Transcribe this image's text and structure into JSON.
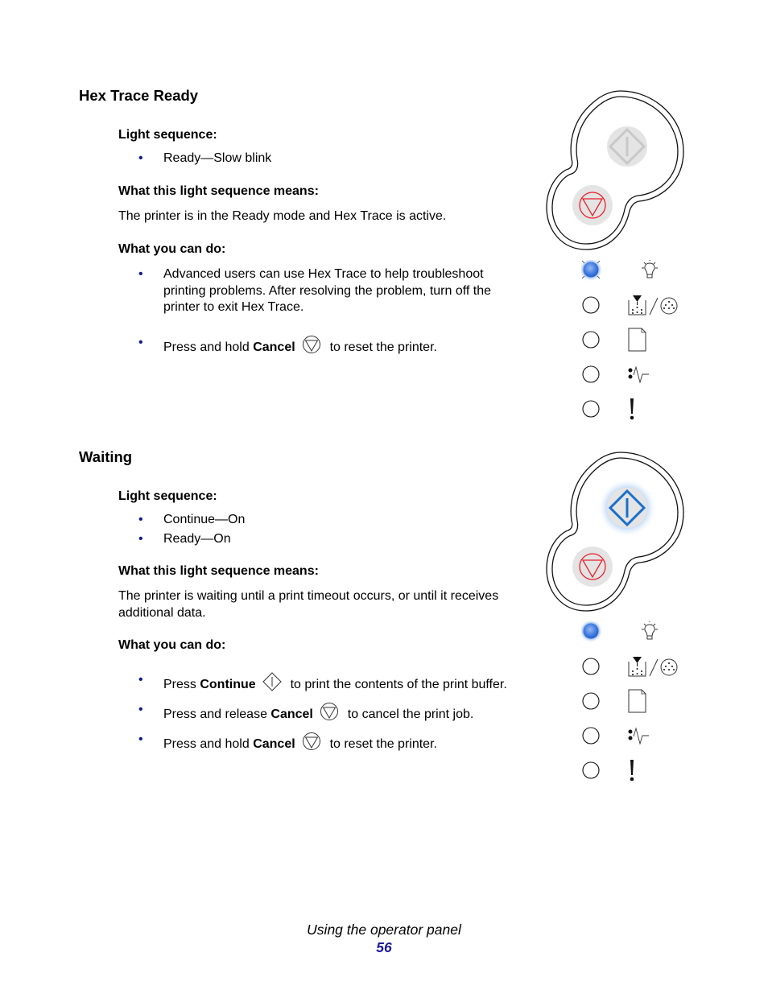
{
  "sections": [
    {
      "title": "Hex Trace Ready",
      "light_sequence_label": "Light sequence:",
      "light_sequence": [
        "Ready—Slow blink"
      ],
      "means_label": "What this light sequence means:",
      "means_text": "The printer is in the Ready mode and Hex Trace is active.",
      "actions_label": "What you can do:",
      "actions": [
        {
          "text": "Advanced users can use Hex Trace to help troubleshoot printing problems. After resolving the problem, turn off the printer to exit Hex Trace."
        },
        {
          "pre": "Press and hold ",
          "bold": "Cancel",
          "icon": "cancel-icon",
          "post": "to reset the printer."
        }
      ],
      "panel": {
        "continue_button": {
          "icon": "continue-icon",
          "state": "off"
        },
        "cancel_button": {
          "icon": "cancel-icon",
          "state": "on",
          "color": "#e8202a"
        },
        "lights": [
          {
            "name": "ready",
            "icon": "lightbulb-icon",
            "state": "slow-blink",
            "color": "#3a78e0"
          },
          {
            "name": "toner-low",
            "icon": "toner-drum-icon",
            "state": "off"
          },
          {
            "name": "load-paper",
            "icon": "paper-icon",
            "state": "off"
          },
          {
            "name": "paper-jam",
            "icon": "paper-jam-icon",
            "state": "off"
          },
          {
            "name": "error",
            "icon": "exclamation-icon",
            "state": "off"
          }
        ]
      }
    },
    {
      "title": "Waiting",
      "light_sequence_label": "Light sequence:",
      "light_sequence": [
        "Continue—On",
        "Ready—On"
      ],
      "means_label": "What this light sequence means:",
      "means_text": "The printer is waiting until a print timeout occurs, or until it receives additional data.",
      "actions_label": "What you can do:",
      "actions": [
        {
          "pre": "Press ",
          "bold": "Continue",
          "icon": "continue-icon",
          "post": "to print the contents of the print buffer."
        },
        {
          "pre": "Press and release ",
          "bold": "Cancel",
          "icon": "cancel-icon",
          "post": "to cancel the print job."
        },
        {
          "pre": "Press and hold ",
          "bold": "Cancel",
          "icon": "cancel-icon",
          "post": "to reset the printer."
        }
      ],
      "panel": {
        "continue_button": {
          "icon": "continue-icon",
          "state": "on",
          "color": "#1a6fcc"
        },
        "cancel_button": {
          "icon": "cancel-icon",
          "state": "on",
          "color": "#e8202a"
        },
        "lights": [
          {
            "name": "ready",
            "icon": "lightbulb-icon",
            "state": "on",
            "color": "#3a78e0"
          },
          {
            "name": "toner-low",
            "icon": "toner-drum-icon",
            "state": "off"
          },
          {
            "name": "load-paper",
            "icon": "paper-icon",
            "state": "off"
          },
          {
            "name": "paper-jam",
            "icon": "paper-jam-icon",
            "state": "off"
          },
          {
            "name": "error",
            "icon": "exclamation-icon",
            "state": "off"
          }
        ]
      }
    }
  ],
  "footer": {
    "section_title": "Using the operator panel",
    "page_number": "56"
  },
  "colors": {
    "bullet": "#0b1a8a",
    "page_number": "#1a1a9a"
  }
}
